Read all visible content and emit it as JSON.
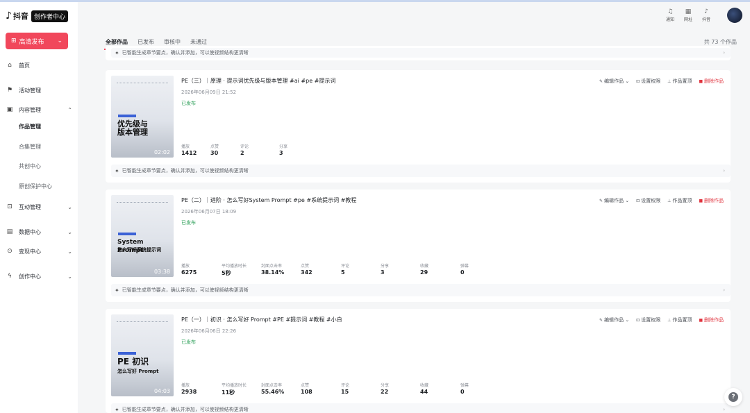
{
  "logo": {
    "symbol": "♪",
    "name": "抖音",
    "badge": "创作者中心"
  },
  "publish": {
    "label": "高清发布",
    "icon": "upload-icon"
  },
  "nav": {
    "home": "首页",
    "activity": "活动管理",
    "content": "内容管理",
    "content_sub": [
      "作品管理",
      "合集管理",
      "共创中心",
      "原创保护中心"
    ],
    "interaction": "互动管理",
    "data": "数据中心",
    "monetize": "变现中心",
    "create": "创作中心"
  },
  "header": {
    "notify": "通知",
    "web": "网址",
    "douyin": "抖音"
  },
  "tabs": [
    "全部作品",
    "已发布",
    "审核中",
    "未通过"
  ],
  "total": "共 73 个作品",
  "hint_text": "已智能生成章节要点，确认并添加，可以使视频结构更清晰",
  "actions": {
    "edit": "编辑作品",
    "perm": "设置权限",
    "pin": "作品置顶",
    "delete": "删除作品"
  },
  "works": [
    {
      "title": "PE（三）｜原理 · 提示词优先级与版本管理 #ai #pe #提示词",
      "time": "2026年06月09日 21:52",
      "status": "已发布",
      "thumb_big": [
        "优先级与",
        "版本管理"
      ],
      "duration": "02:02",
      "stats": [
        {
          "label": "播放",
          "value": "1412"
        },
        {
          "label": "点赞",
          "value": "30"
        },
        {
          "label": "评论",
          "value": "2"
        },
        {
          "label": "分享",
          "value": "3"
        }
      ]
    },
    {
      "title": "PE（二）｜进阶 · 怎么写好System Prompt #pe #系统提示词 #教程",
      "time": "2026年06月07日 18:09",
      "status": "已发布",
      "thumb_big": [
        "System Prompt",
        "怎么写好系统提示词"
      ],
      "duration": "03:38",
      "stats": [
        {
          "label": "播放",
          "value": "6275"
        },
        {
          "label": "平均播放时长",
          "value": "5秒"
        },
        {
          "label": "封面点击率",
          "value": "38.14%"
        },
        {
          "label": "点赞",
          "value": "342"
        },
        {
          "label": "评论",
          "value": "5"
        },
        {
          "label": "分享",
          "value": "3"
        },
        {
          "label": "收藏",
          "value": "29"
        },
        {
          "label": "弹幕",
          "value": "0"
        }
      ]
    },
    {
      "title": "PE（一）｜初识 · 怎么写好 Prompt #PE #提示词 #教程 #小白",
      "time": "2026年06月06日 22:26",
      "status": "已发布",
      "thumb_big": [
        "PE 初识",
        "怎么写好 Prompt"
      ],
      "duration": "04:03",
      "stats": [
        {
          "label": "播放",
          "value": "2938"
        },
        {
          "label": "平均播放时长",
          "value": "11秒"
        },
        {
          "label": "封面点击率",
          "value": "55.46%"
        },
        {
          "label": "点赞",
          "value": "108"
        },
        {
          "label": "评论",
          "value": "15"
        },
        {
          "label": "分享",
          "value": "22"
        },
        {
          "label": "收藏",
          "value": "44"
        },
        {
          "label": "弹幕",
          "value": "0"
        }
      ]
    }
  ],
  "colors": {
    "brand": "#f1475b",
    "success": "#2fa05a",
    "danger": "#e0343f"
  }
}
